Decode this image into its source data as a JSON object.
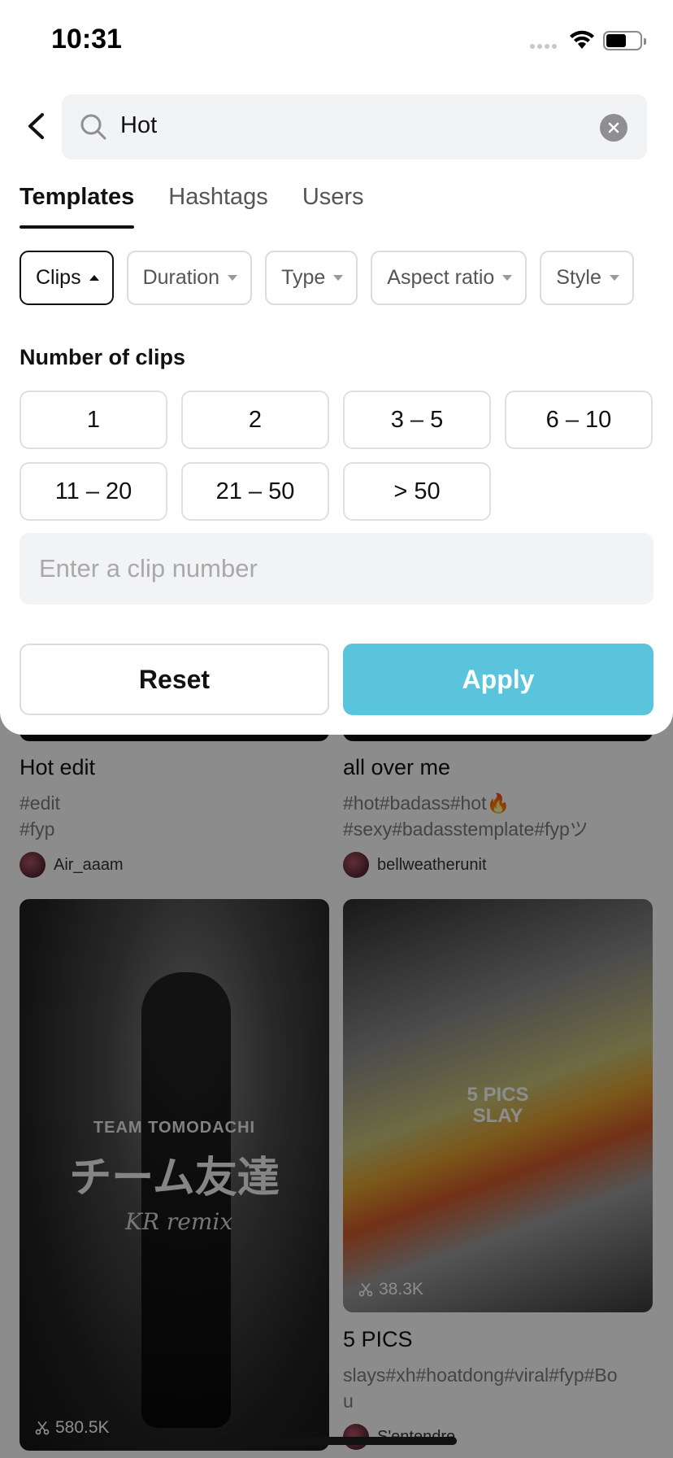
{
  "status_bar": {
    "time": "10:31"
  },
  "search": {
    "query": "Hot"
  },
  "tabs": [
    {
      "label": "Templates",
      "active": true
    },
    {
      "label": "Hashtags",
      "active": false
    },
    {
      "label": "Users",
      "active": false
    }
  ],
  "filters": [
    {
      "label": "Clips",
      "active": true
    },
    {
      "label": "Duration",
      "active": false
    },
    {
      "label": "Type",
      "active": false
    },
    {
      "label": "Aspect ratio",
      "active": false
    },
    {
      "label": "Style",
      "active": false
    }
  ],
  "clips_panel": {
    "title": "Number of clips",
    "options": [
      "1",
      "2",
      "3 – 5",
      "6 – 10",
      "11 – 20",
      "21 – 50",
      "> 50"
    ],
    "input_placeholder": "Enter a clip number",
    "reset_label": "Reset",
    "apply_label": "Apply"
  },
  "feed": {
    "left": {
      "card1": {
        "title": "Hot edit",
        "tags_line1": "#edit",
        "tags_line2": "#fyp",
        "user": "Air_aaam"
      },
      "card2": {
        "overlay_line1": "TEAM TOMODACHI",
        "overlay_line2": "チーム友達",
        "overlay_line3": "KR remix",
        "uses": "580.5K"
      }
    },
    "right": {
      "card1": {
        "title": "all over me",
        "tags_line1": "#hot#badass#hot🔥",
        "tags_line2": "#sexy#badasstemplate#fypツ",
        "user": "bellweatherunit"
      },
      "card2": {
        "overlay_line1": "5 PICS",
        "overlay_line2": "SLAY",
        "uses": "38.3K",
        "title": "5 PICS",
        "tags_line1": "slays#xh#hoatdong#viral#fyp#Bo",
        "tags_line2": "u",
        "user": "S'entendre"
      }
    }
  },
  "colors": {
    "accent": "#5ac4dc",
    "active_border": "#111111"
  }
}
